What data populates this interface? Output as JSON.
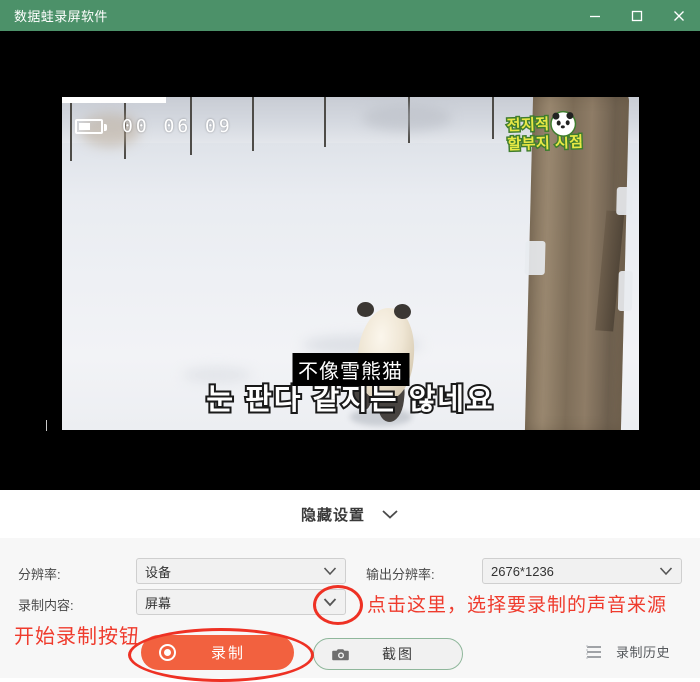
{
  "window": {
    "title": "数据蛙录屏软件",
    "accent_color": "#4c9169",
    "controls": [
      {
        "name": "minimize",
        "glyph": "—"
      },
      {
        "name": "maximize",
        "glyph": "□"
      },
      {
        "name": "close",
        "glyph": "✕"
      }
    ]
  },
  "preview": {
    "hud_timecode": "00 06 09",
    "watermark_line1": "전지적",
    "watermark_line2": "할부지 시점",
    "subtitle": "눈 판다 같지는 않네요",
    "subtitle_tooltip": "不像雪熊猫"
  },
  "settings_toggle": {
    "label": "隐藏设置",
    "icon": "chevron-down-icon"
  },
  "settings": {
    "resolution": {
      "label": "分辨率:",
      "value": "设备"
    },
    "output_resolution": {
      "label": "输出分辨率:",
      "value": "2676*1236"
    },
    "record_content": {
      "label": "录制内容:",
      "value": "屏幕"
    }
  },
  "actions": {
    "record_label": "录制",
    "record_color": "#f2613f",
    "snapshot_label": "截图",
    "snapshot_icon": "camera-icon",
    "history_label": "录制历史",
    "history_icon": "list-icon"
  },
  "annotations": {
    "color": "#ef3b2d",
    "audio_source": "点击这里，选择要录制的声音来源",
    "start_record": "开始录制按钮"
  }
}
